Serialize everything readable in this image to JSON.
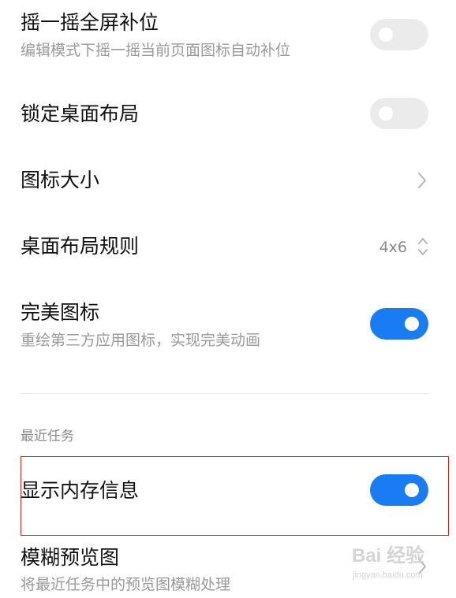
{
  "settings": {
    "shake_fill": {
      "title": "摇一摇全屏补位",
      "subtitle": "编辑模式下摇一摇当前页面图标自动补位",
      "enabled": false
    },
    "lock_layout": {
      "title": "锁定桌面布局",
      "enabled": false
    },
    "icon_size": {
      "title": "图标大小"
    },
    "layout_rule": {
      "title": "桌面布局规则",
      "value": "4x6"
    },
    "perfect_icons": {
      "title": "完美图标",
      "subtitle": "重绘第三方应用图标，实现完美动画",
      "enabled": true
    }
  },
  "recent_tasks": {
    "header": "最近任务",
    "show_memory": {
      "title": "显示内存信息",
      "enabled": true
    },
    "blur_preview": {
      "title": "模糊预览图",
      "subtitle": "将最近任务中的预览图模糊处理"
    }
  },
  "watermark": {
    "main": "Bai 经验",
    "sub": "jingyan.baidu.com"
  },
  "icons": {
    "chevron": "chevron-right-icon",
    "updown": "chevron-up-down-icon",
    "toggle_on_color": "#1a7cf2",
    "toggle_off_color": "#ebebeb",
    "highlight_color": "#d9251c"
  }
}
